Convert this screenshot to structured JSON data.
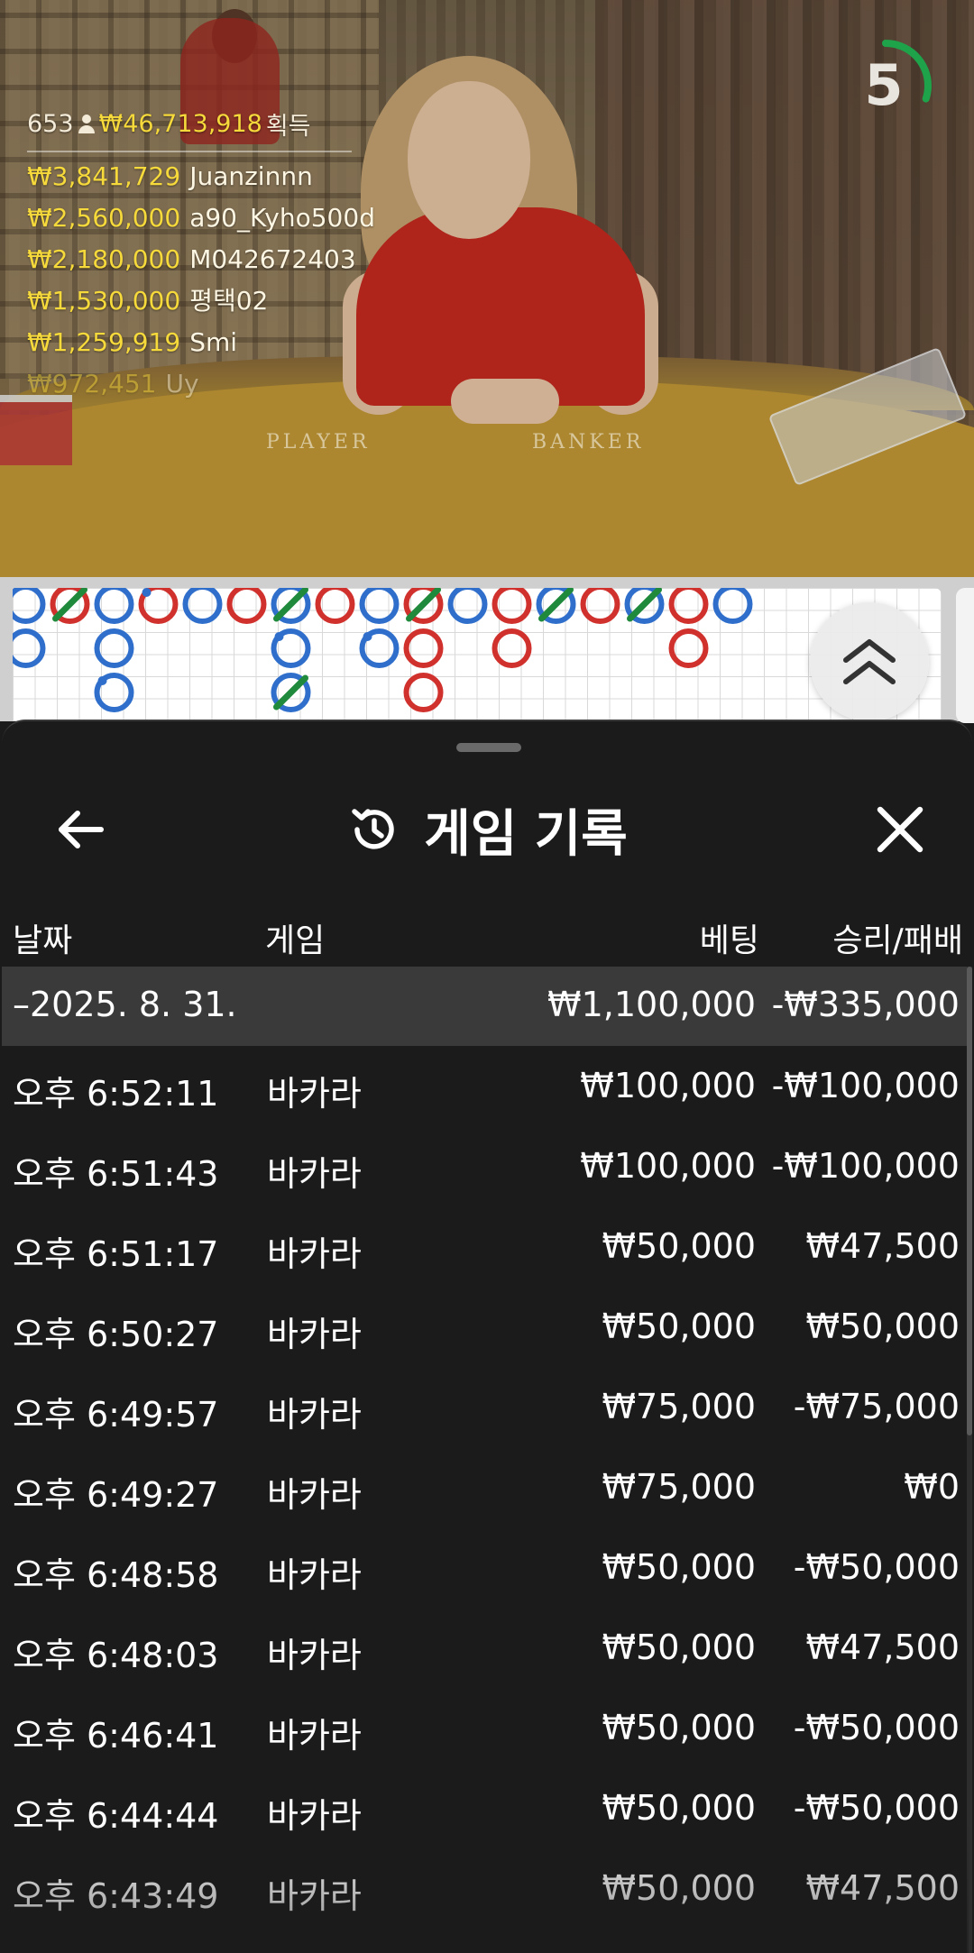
{
  "leaderboard": {
    "players": "653",
    "total": "₩46,713,918",
    "suffix": "획득",
    "rows": [
      {
        "amount": "₩3,841,729",
        "name": "Juanzinnn"
      },
      {
        "amount": "₩2,560,000",
        "name": "a90_Kyho500d"
      },
      {
        "amount": "₩2,180,000",
        "name": "M042672403"
      },
      {
        "amount": "₩1,530,000",
        "name": "평택02"
      },
      {
        "amount": "₩1,259,919",
        "name": "Smi"
      },
      {
        "amount": "₩972,451",
        "name": "Uy"
      }
    ]
  },
  "timer": {
    "value": "5",
    "progress": 0.3,
    "color": "#1fa34a"
  },
  "table_felt": {
    "player_label": "PLAYER",
    "banker_label": "BANKER"
  },
  "roadmap": {
    "colors": {
      "banker": "#d0312d",
      "player": "#2f6fcb",
      "tie": "#1f8a3b"
    },
    "columns": [
      [
        "P",
        "P"
      ],
      [
        "B*"
      ],
      [
        "P",
        "P",
        "P!"
      ],
      [
        "B!"
      ],
      [
        "P"
      ],
      [
        "B"
      ],
      [
        "P*",
        "P!",
        "P*"
      ],
      [
        "B"
      ],
      [
        "P",
        "P!"
      ],
      [
        "B*",
        "B",
        "B"
      ],
      [
        "P"
      ],
      [
        "B",
        "B"
      ],
      [
        "P*"
      ],
      [
        "B"
      ],
      [
        "P*"
      ],
      [
        "B",
        "B"
      ],
      [
        "P"
      ]
    ]
  },
  "sheet": {
    "title": "게임 기록",
    "back_icon": "arrow-left-icon",
    "history_icon": "history-icon",
    "close_icon": "close-icon"
  },
  "table": {
    "headers": {
      "date": "날짜",
      "game": "게임",
      "bet": "베팅",
      "win_loss": "승리/패배"
    },
    "group": {
      "date": "–2025. 8. 31.",
      "bet": "₩1,100,000",
      "win_loss": "-₩335,000"
    },
    "rows": [
      {
        "time": "오후 6:52:11",
        "game": "바카라",
        "bet": "₩100,000",
        "win_loss": "-₩100,000"
      },
      {
        "time": "오후 6:51:43",
        "game": "바카라",
        "bet": "₩100,000",
        "win_loss": "-₩100,000"
      },
      {
        "time": "오후 6:51:17",
        "game": "바카라",
        "bet": "₩50,000",
        "win_loss": "₩47,500"
      },
      {
        "time": "오후 6:50:27",
        "game": "바카라",
        "bet": "₩50,000",
        "win_loss": "₩50,000"
      },
      {
        "time": "오후 6:49:57",
        "game": "바카라",
        "bet": "₩75,000",
        "win_loss": "-₩75,000"
      },
      {
        "time": "오후 6:49:27",
        "game": "바카라",
        "bet": "₩75,000",
        "win_loss": "₩0"
      },
      {
        "time": "오후 6:48:58",
        "game": "바카라",
        "bet": "₩50,000",
        "win_loss": "-₩50,000"
      },
      {
        "time": "오후 6:48:03",
        "game": "바카라",
        "bet": "₩50,000",
        "win_loss": "₩47,500"
      },
      {
        "time": "오후 6:46:41",
        "game": "바카라",
        "bet": "₩50,000",
        "win_loss": "-₩50,000"
      },
      {
        "time": "오후 6:44:44",
        "game": "바카라",
        "bet": "₩50,000",
        "win_loss": "-₩50,000"
      },
      {
        "time": "오후 6:43:49",
        "game": "바카라",
        "bet": "₩50,000",
        "win_loss": "₩47,500"
      }
    ]
  }
}
